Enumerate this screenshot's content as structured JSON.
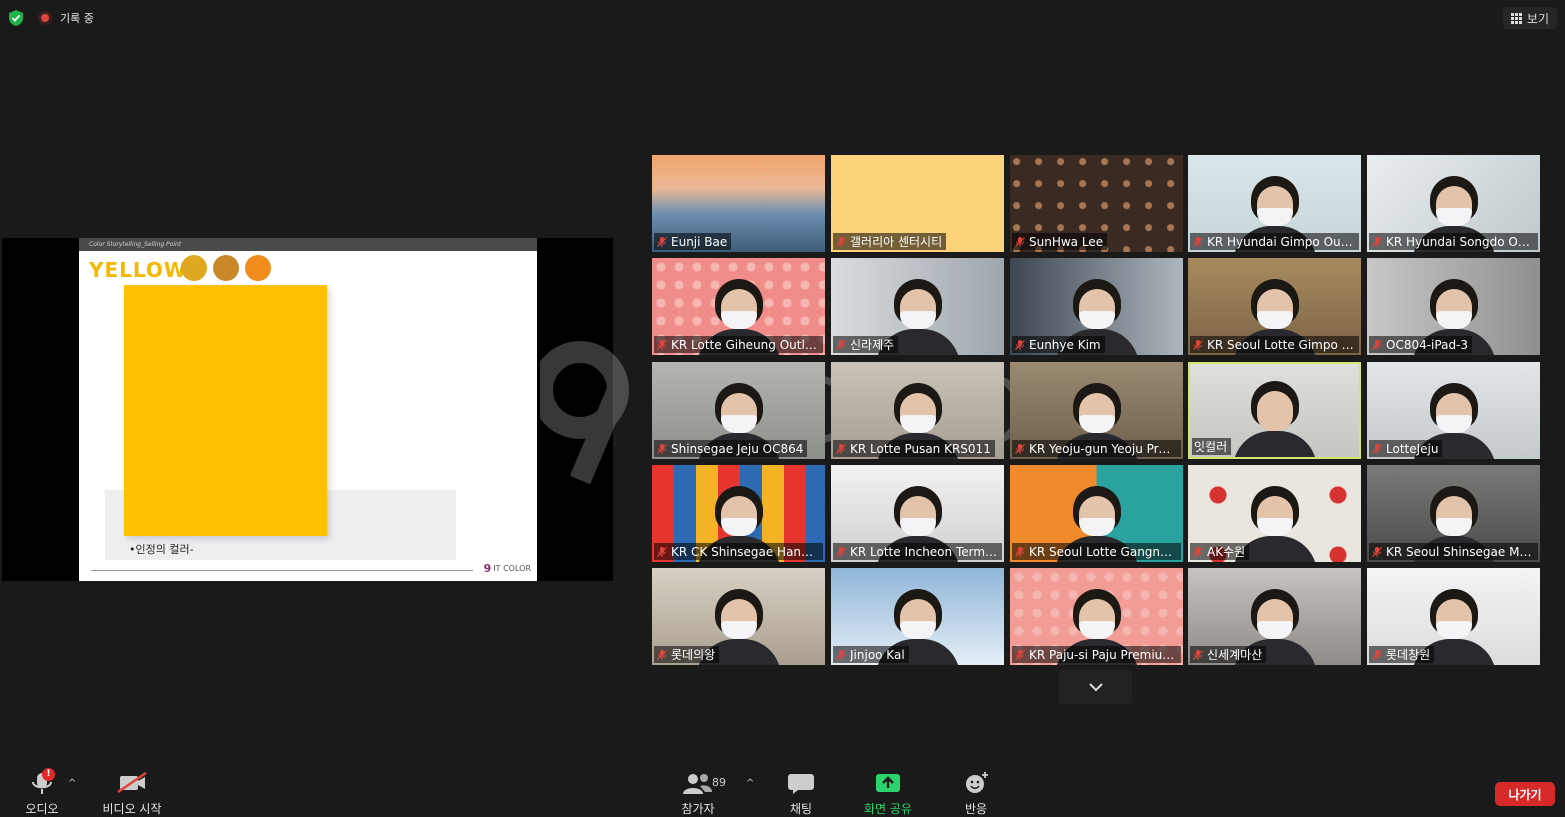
{
  "top": {
    "recording_label": "기록 중",
    "view_label": "보기"
  },
  "slide": {
    "header": "Color Storytelling_Selling Point",
    "title": "YELLOW",
    "caption": "•인정의 컬러-",
    "logo_text": "IT COLOR",
    "colors": {
      "yellow": "#ffc000",
      "title": "#f5b800",
      "swatch1": "#e0a820",
      "swatch2": "#c9882a",
      "swatch3": "#f08c1c"
    }
  },
  "watermark": "IT COLOR",
  "participants": [
    {
      "name": "Eunji Bae"
    },
    {
      "name": "갤러리아 센터시티"
    },
    {
      "name": "SunHwa Lee"
    },
    {
      "name": "KR Hyundai Gimpo Outl..."
    },
    {
      "name": "KR Hyundai Songdo Out..."
    },
    {
      "name": "KR Lotte Giheung Outlet..."
    },
    {
      "name": "신라제주"
    },
    {
      "name": "Eunhye Kim"
    },
    {
      "name": "KR Seoul Lotte Gimpo K..."
    },
    {
      "name": "OC804-iPad-3"
    },
    {
      "name": "Shinsegae Jeju OC864"
    },
    {
      "name": "KR Lotte Pusan KRS011"
    },
    {
      "name": "KR Yeoju-gun Yeoju Pre..."
    },
    {
      "name": "잇컬러",
      "active": true
    },
    {
      "name": "LotteJeju"
    },
    {
      "name": "KR CK Shinsegae Hana..."
    },
    {
      "name": "KR Lotte Incheon Termin..."
    },
    {
      "name": "KR Seoul Lotte Gangna..."
    },
    {
      "name": "AK수원"
    },
    {
      "name": "KR Seoul Shinsegae Mai..."
    },
    {
      "name": "롯데의왕"
    },
    {
      "name": "Jinjoo Kal"
    },
    {
      "name": "KR Paju-si Paju Premium..."
    },
    {
      "name": "신세계마산"
    },
    {
      "name": "롯데창원"
    }
  ],
  "toolbar": {
    "audio_label": "오디오",
    "audio_badge": "!",
    "video_label": "비디오 시작",
    "participants_label": "참가자",
    "participants_count": "89",
    "chat_label": "채팅",
    "share_label": "화면 공유",
    "reactions_label": "반응",
    "leave_label": "나가기"
  },
  "colors": {
    "active_speaker": "#d6e56e",
    "share_green": "#2bd36c",
    "leave_red": "#d5292a"
  }
}
